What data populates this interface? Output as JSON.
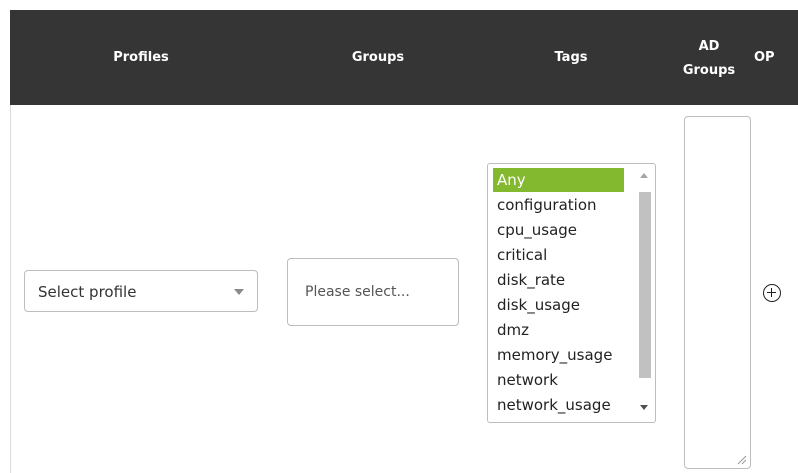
{
  "header": {
    "profiles": "Profiles",
    "groups": "Groups",
    "tags": "Tags",
    "ad_groups_line1": "AD",
    "ad_groups_line2": "Groups",
    "op": "OP"
  },
  "profile_select": {
    "value": "Select profile"
  },
  "groups_select": {
    "placeholder": "Please select..."
  },
  "tags": {
    "selected": "Any",
    "items": [
      "Any",
      "configuration",
      "cpu_usage",
      "critical",
      "disk_rate",
      "disk_usage",
      "dmz",
      "memory_usage",
      "network",
      "network_usage"
    ]
  },
  "icons": {
    "profile_dropdown": "chevron-down-icon",
    "add": "plus-circle-icon",
    "resize": "resize-grip-icon"
  },
  "colors": {
    "header_bg": "#353535",
    "selected_tag": "#82b92e"
  }
}
